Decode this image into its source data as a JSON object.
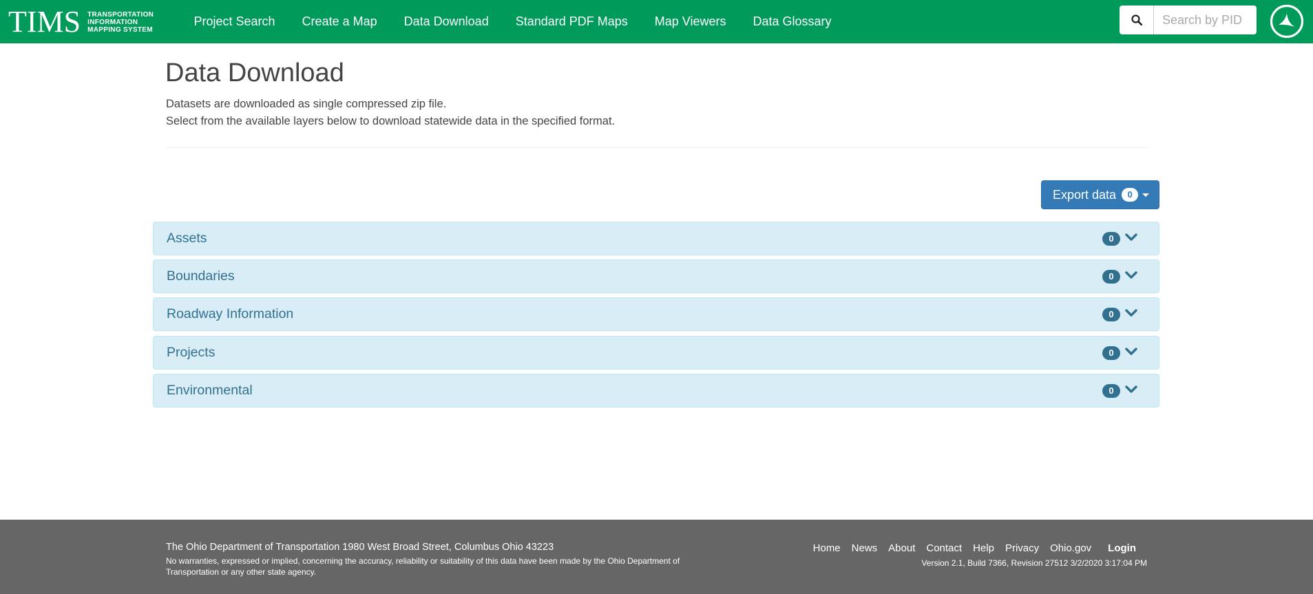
{
  "header": {
    "brand": "TIMS",
    "brand_sub": [
      "TRANSPORTATION",
      "INFORMATION",
      "MAPPING SYSTEM"
    ],
    "nav": [
      {
        "label": "Project Search"
      },
      {
        "label": "Create a Map"
      },
      {
        "label": "Data Download"
      },
      {
        "label": "Standard PDF Maps"
      },
      {
        "label": "Map Viewers"
      },
      {
        "label": "Data Glossary"
      }
    ],
    "search": {
      "placeholder": "Search by PID",
      "value": ""
    },
    "colors": {
      "navbar": "#009a5b"
    }
  },
  "main": {
    "title": "Data Download",
    "description_line1": "Datasets are downloaded as single compressed zip file.",
    "description_line2": "Select from the available layers below to download statewide data in the specified format.",
    "export": {
      "label": "Export data",
      "count": "0",
      "color": "#337ab7"
    },
    "panels": [
      {
        "title": "Assets",
        "count": "0"
      },
      {
        "title": "Boundaries",
        "count": "0"
      },
      {
        "title": "Roadway Information",
        "count": "0"
      },
      {
        "title": "Projects",
        "count": "0"
      },
      {
        "title": "Environmental",
        "count": "0"
      }
    ]
  },
  "footer": {
    "address": "The Ohio Department of Transportation 1980 West Broad Street, Columbus Ohio 43223",
    "disclaimer": "No warranties, expressed or implied, concerning the accuracy, reliability or suitability of this data have been made by the Ohio Department of Transportation or any other state agency.",
    "links": [
      "Home",
      "News",
      "About",
      "Contact",
      "Help",
      "Privacy",
      "Ohio.gov"
    ],
    "login": "Login",
    "version": "Version 2.1, Build 7366, Revision 27512 3/2/2020 3:17:04 PM"
  }
}
